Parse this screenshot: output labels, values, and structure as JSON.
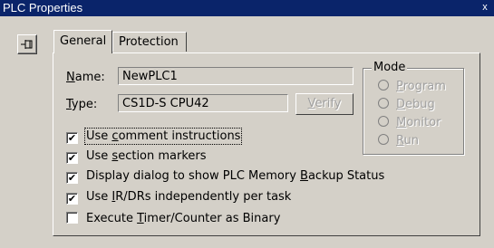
{
  "window": {
    "title": "PLC Properties",
    "close_glyph": "x"
  },
  "pin_button": {
    "icon": "pushpin-icon",
    "glyph": "-⍔"
  },
  "tabs": [
    {
      "label": "General",
      "active": true
    },
    {
      "label": "Protection",
      "active": false
    }
  ],
  "general": {
    "name_label_u": "N",
    "name_label_rest": "ame:",
    "name_value": "NewPLC1",
    "type_label_u": "T",
    "type_label_rest": "ype:",
    "type_value": "CS1D-S CPU42",
    "verify_u": "V",
    "verify_rest": "erify",
    "mode": {
      "legend": "Mode",
      "options": [
        {
          "u": "P",
          "rest": "rogram"
        },
        {
          "u": "D",
          "rest": "ebug"
        },
        {
          "u": "M",
          "rest": "onitor"
        },
        {
          "u": "R",
          "rest": "un"
        }
      ]
    },
    "checkboxes": [
      {
        "pre": "Use ",
        "u": "c",
        "post": "omment instructions",
        "checked": true
      },
      {
        "pre": "Use ",
        "u": "s",
        "post": "ection markers",
        "checked": true
      },
      {
        "pre": "Display dialog to show PLC Memory ",
        "u": "B",
        "post": "ackup Status",
        "checked": true
      },
      {
        "pre": "Use ",
        "u": "I",
        "post": "R/DRs independently per task",
        "checked": true
      },
      {
        "pre": "Execute ",
        "u": "T",
        "post": "imer/Counter as Binary",
        "checked": false
      }
    ],
    "check_mark": "✔"
  }
}
